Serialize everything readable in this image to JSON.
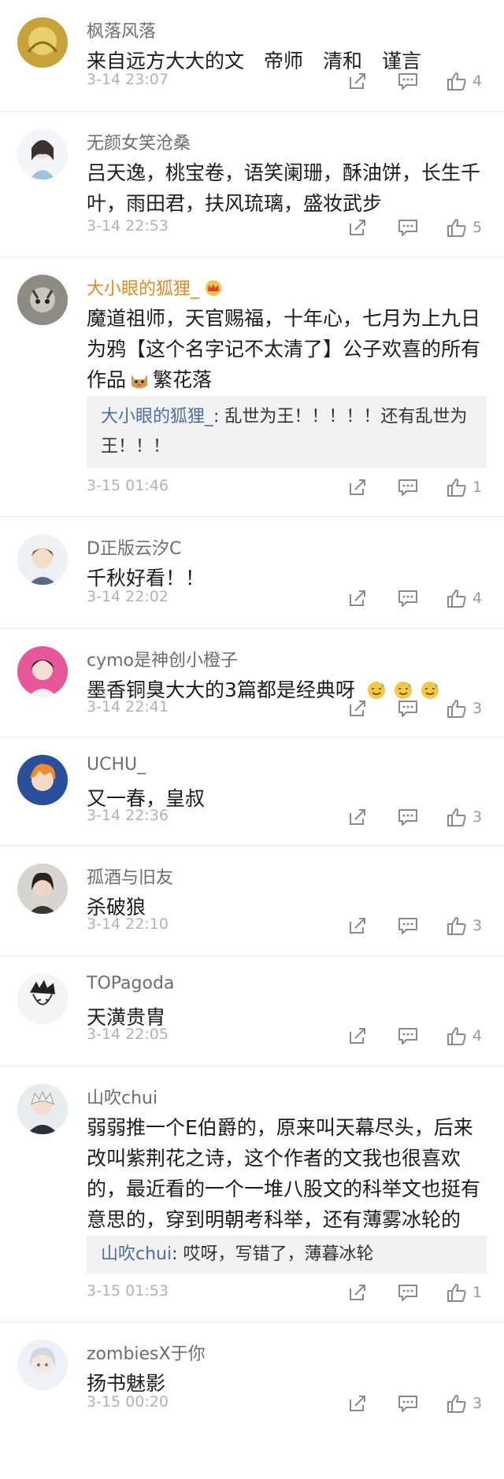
{
  "comments": [
    {
      "user": "枫落风落",
      "text": "来自远方大大的文　帝师　清和　谨言",
      "time": "3-14 23:07",
      "likes": "4"
    },
    {
      "user": "无颜女笑沧桑",
      "text": "吕天逸，桃宝卷，语笑阑珊，酥油饼，长生千叶，雨田君，扶风琉璃，盛妆武步",
      "time": "3-14 22:53",
      "likes": "5"
    },
    {
      "user": "大小眼的狐狸_",
      "text_before": "魔道祖师，天官赐福，十年心，七月为上九日为鸦【这个名字记不太清了】公子欢喜的所有作品",
      "text_after": "繁花落",
      "reply_name": "大小眼的狐狸_",
      "reply_text": "乱世为王！！！！！还有乱世为王！！！",
      "time": "3-15 01:46",
      "likes": "1"
    },
    {
      "user": "D正版云汐C",
      "text": "千秋好看！！",
      "time": "3-14 22:02",
      "likes": "4"
    },
    {
      "user": "cymo是神创小橙子",
      "text": "墨香铜臭大大的3篇都是经典呀",
      "time": "3-14 22:41",
      "likes": "3"
    },
    {
      "user": "UCHU_",
      "text": "又一春，皇叔",
      "time": "3-14 22:36",
      "likes": "3"
    },
    {
      "user": "孤酒与旧友",
      "text": "杀破狼",
      "time": "3-14 22:10",
      "likes": "3"
    },
    {
      "user": "TOPagoda",
      "text": "天潢贵胄",
      "time": "3-14 22:05",
      "likes": "4"
    },
    {
      "user": "山吹chui",
      "text": "弱弱推一个E伯爵的，原来叫天幕尽头，后来改叫紫荆花之诗，这个作者的文我也很喜欢的，最近看的一个一堆八股文的科举文也挺有意思的，穿到明朝考科举，还有薄雾冰轮的文，好看的",
      "reply_name": "山吹chui",
      "reply_text": "哎呀，写错了，薄暮冰轮",
      "time": "3-15 01:53",
      "likes": "1"
    },
    {
      "user": "zombiesX于你",
      "text": "扬书魅影",
      "time": "3-15 00:20",
      "likes": "3"
    }
  ],
  "reply_separator": ": ",
  "icons": {
    "share": "share-icon",
    "reply": "comment-icon",
    "like": "thumbs-up-icon",
    "crown": "crown-icon",
    "emoji": "sweat-smile-emoji"
  },
  "colors": {
    "username": "#6d6d6d",
    "vip_username": "#e08a1e",
    "reply_name": "#4a6fa5",
    "time": "#b2b2b2"
  }
}
